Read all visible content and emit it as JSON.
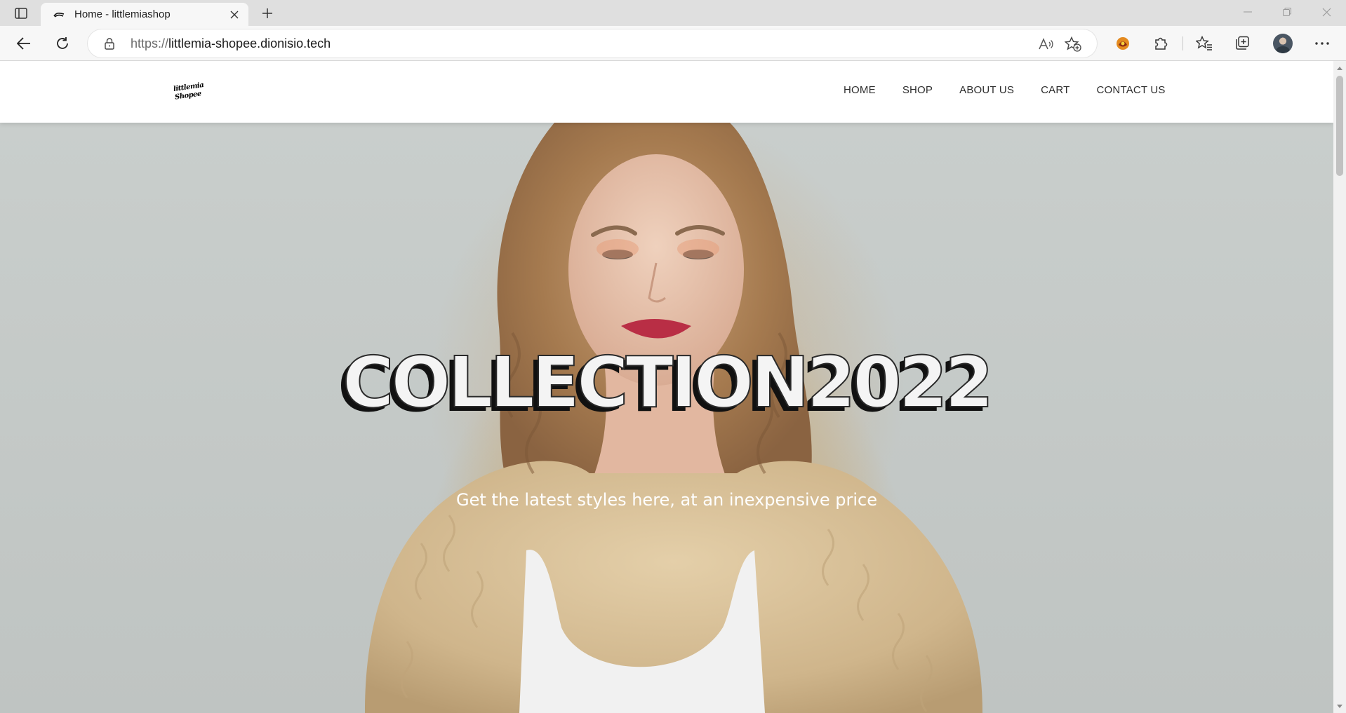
{
  "browser": {
    "tab": {
      "title": "Home - littlemiashop"
    },
    "address": {
      "scheme": "https://",
      "host": "littlemia-shopee.dionisio.tech"
    }
  },
  "site": {
    "logo": {
      "line1": "littlemia",
      "line2": "Shopee"
    },
    "nav": [
      {
        "label": "HOME"
      },
      {
        "label": "SHOP"
      },
      {
        "label": "ABOUT US"
      },
      {
        "label": "CART"
      },
      {
        "label": "CONTACT US"
      }
    ]
  },
  "hero": {
    "title": "COLLECTION2022",
    "subtitle": "Get the latest styles here, at an inexpensive price"
  },
  "colors": {
    "tabbar": "#dfdfdf",
    "toolbar": "#f7f7f7",
    "hero_background": "#c6cbc9",
    "title_fill": "#f4f4f4",
    "title_shadow": "#111111"
  },
  "icons": {
    "tab_actions": "tab-actions-icon",
    "favicon": "littlemia-favicon",
    "close_tab": "close-icon",
    "new_tab": "plus-icon",
    "minimize": "minimize-icon",
    "restore": "restore-icon",
    "close_window": "close-icon",
    "back": "back-arrow-icon",
    "refresh": "refresh-icon",
    "lock": "lock-icon",
    "read_aloud": "read-aloud-icon",
    "add_favorite": "add-favorite-icon",
    "extension": "extension-icon",
    "extensions": "puzzle-icon",
    "favorites": "favorites-icon",
    "collections": "collections-icon",
    "profile": "avatar",
    "more": "more-icon"
  }
}
